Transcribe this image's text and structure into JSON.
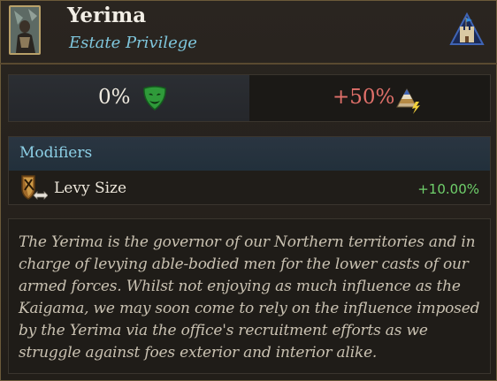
{
  "header": {
    "title": "Yerima",
    "subtitle": "Estate Privilege",
    "portrait_icon": "portrait-icon",
    "estate_icon": "castle-estate-icon"
  },
  "stats": {
    "loyalty_value": "0%",
    "loyalty_icon": "green-mask-icon",
    "influence_value": "+50%",
    "influence_icon": "power-pyramid-icon",
    "influence_color": "#e0706a"
  },
  "modifiers": {
    "title": "Modifiers",
    "items": [
      {
        "icon": "levy-size-icon",
        "label": "Levy Size",
        "value": "+10.00%",
        "color": "#6fd06b"
      }
    ]
  },
  "description": {
    "text": "The Yerima is the governor of our Northern territories and in charge of levying able-bodied men for the lower casts of our armed forces. Whilst not enjoying as much influence as the Kaigama, we may soon come to rely on the influence imposed by the Yerima via the office's recruitment efforts as we struggle against foes exterior and interior alike."
  },
  "colors": {
    "accent_blue": "#7fc6dc",
    "border_gold": "#6b5a3a"
  }
}
